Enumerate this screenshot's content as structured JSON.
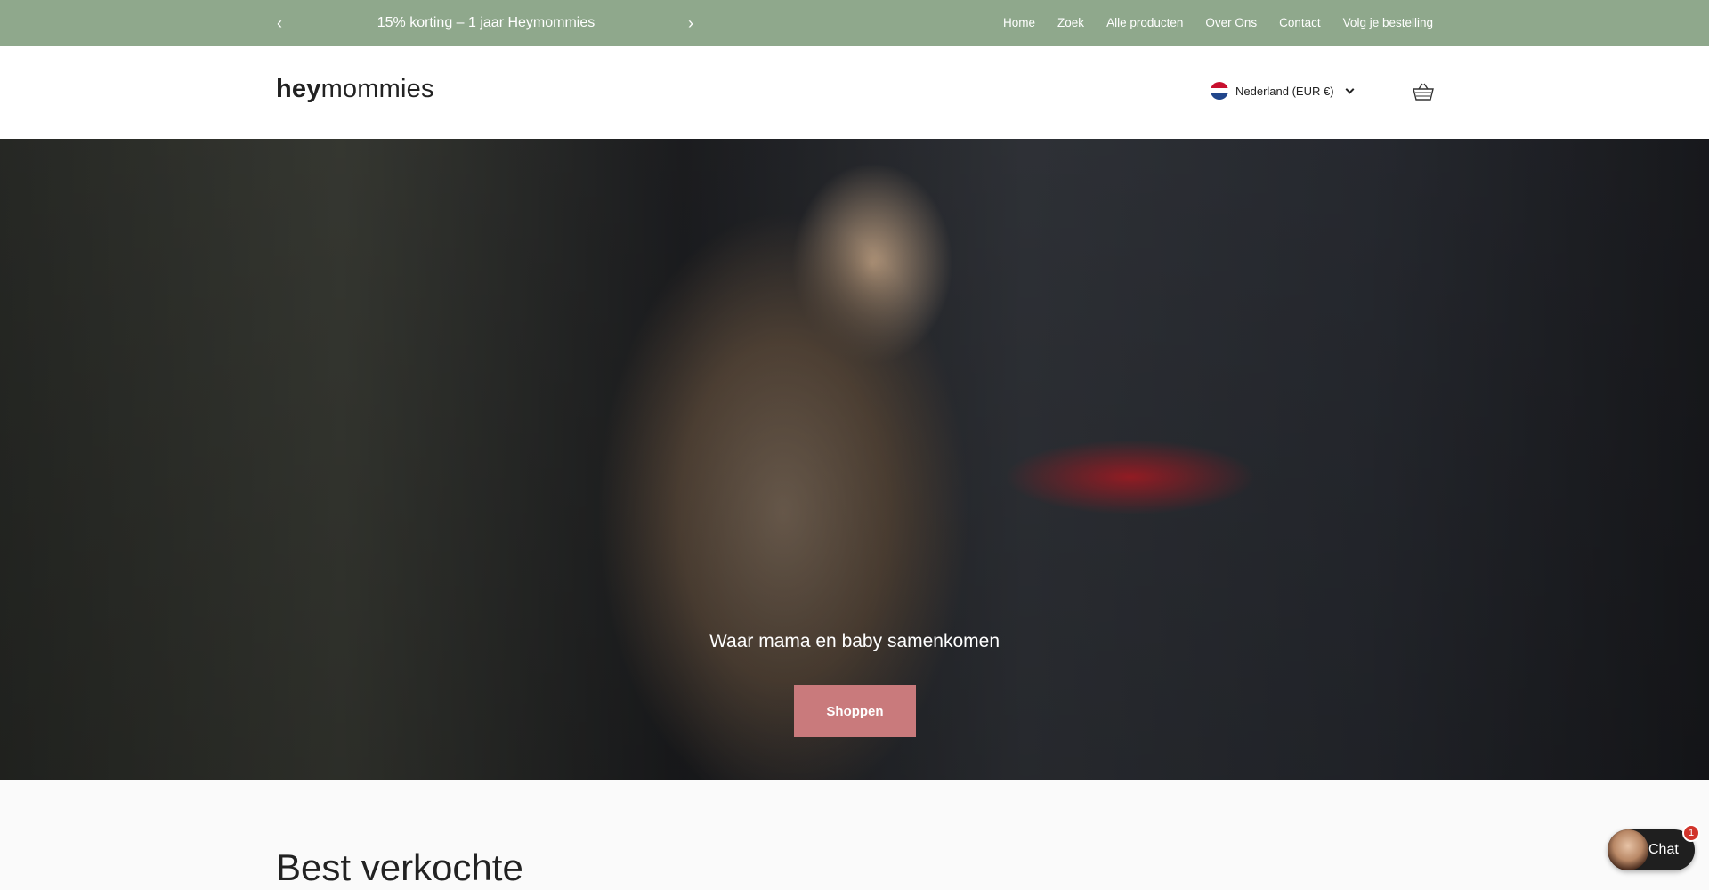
{
  "announcement": {
    "prev_icon": "‹",
    "next_icon": "›",
    "message": "15% korting – 1 jaar Heymommies",
    "nav": [
      "Home",
      "Zoek",
      "Alle producten",
      "Over Ons",
      "Contact",
      "Volg je bestelling"
    ]
  },
  "header": {
    "logo_bold": "hey",
    "logo_light": "mommies",
    "country": "Nederland (EUR €)",
    "cart_icon": "basket-icon"
  },
  "hero": {
    "heading": "Waar mama en baby samenkomen",
    "button": "Shoppen"
  },
  "section": {
    "title": "Best verkochte"
  },
  "chat": {
    "label": "Chat",
    "badge": "1"
  },
  "colors": {
    "announcement_bg": "#8fa88c",
    "button_bg": "#c97a7c",
    "chat_bg": "#1f1f1f",
    "badge_bg": "#d1342b"
  }
}
